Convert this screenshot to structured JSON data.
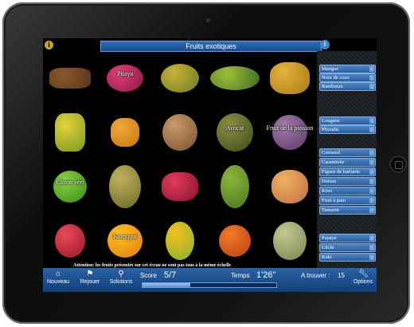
{
  "title": "Fruits exotiques",
  "hint_icon": "lightbulb-icon",
  "info_icon": "info-icon",
  "tiles": [
    {
      "label": "",
      "c1": "#8a5a2e",
      "c2": "#5a3416",
      "w": 52,
      "h": 26,
      "r": "30%"
    },
    {
      "label": "Pitaya",
      "c1": "#e0407a",
      "c2": "#8a1742",
      "w": 46,
      "h": 34,
      "r": "50%"
    },
    {
      "label": "",
      "c1": "#c8b23a",
      "c2": "#6b7a20",
      "w": 48,
      "h": 36,
      "r": "50%"
    },
    {
      "label": "",
      "c1": "#9ebe3a",
      "c2": "#3e6a20",
      "w": 62,
      "h": 30,
      "r": "50%"
    },
    {
      "label": "",
      "c1": "#e6b23a",
      "c2": "#a87a14",
      "w": 50,
      "h": 40,
      "r": "40%"
    },
    {
      "label": "",
      "c1": "#e2d23a",
      "c2": "#7a9a1e",
      "w": 38,
      "h": 48,
      "r": "30%"
    },
    {
      "label": "",
      "c1": "#f0a838",
      "c2": "#c47810",
      "w": 36,
      "h": 36,
      "r": "40%"
    },
    {
      "label": "",
      "c1": "#c89a6a",
      "c2": "#7a5230",
      "w": 44,
      "h": 46,
      "r": "50%"
    },
    {
      "label": "Avocat",
      "c1": "#8a8e44",
      "c2": "#3e4a18",
      "w": 46,
      "h": 48,
      "r": "50%"
    },
    {
      "label": "Fruit de la passion",
      "c1": "#a07aa8",
      "c2": "#5a3a66",
      "w": 44,
      "h": 44,
      "r": "50%"
    },
    {
      "label": "Citron vert",
      "c1": "#86d040",
      "c2": "#3c8a18",
      "w": 42,
      "h": 40,
      "r": "50%"
    },
    {
      "label": "",
      "c1": "#c0b060",
      "c2": "#6a6a22",
      "w": 40,
      "h": 54,
      "r": "50%"
    },
    {
      "label": "",
      "c1": "#e03a5a",
      "c2": "#8a1430",
      "w": 46,
      "h": 36,
      "r": "40%"
    },
    {
      "label": "",
      "c1": "#8ab43a",
      "c2": "#4a7a1e",
      "w": 36,
      "h": 54,
      "r": "50%"
    },
    {
      "label": "",
      "c1": "#f0b060",
      "c2": "#c07040",
      "w": 46,
      "h": 42,
      "r": "45%"
    },
    {
      "label": "",
      "c1": "#e84a5a",
      "c2": "#9a1628",
      "w": 38,
      "h": 42,
      "r": "50%"
    },
    {
      "label": "Kumquat",
      "c1": "#ffc020",
      "c2": "#e07a10",
      "w": 44,
      "h": 42,
      "r": "50%"
    },
    {
      "label": "",
      "c1": "#f0c020",
      "c2": "#8ab030",
      "w": 36,
      "h": 48,
      "r": "50%"
    },
    {
      "label": "",
      "c1": "#f07a2a",
      "c2": "#b8400e",
      "w": 40,
      "h": 40,
      "r": "50%"
    },
    {
      "label": "",
      "c1": "#c4c890",
      "c2": "#7a8250",
      "w": 42,
      "h": 48,
      "r": "50%"
    }
  ],
  "notice": "Attention: les fruits présentés sur cet écran ne sont pas tous à la même échelle",
  "answers": [
    "Mangue",
    "Noix de coco",
    "Rambutan",
    "Longane",
    "Physalis",
    "Corossol",
    "Carambole",
    "Figues de barbarie",
    "Durian",
    "Kiwi",
    "Fruit à pain",
    "Tamarin",
    "Papaye",
    "Litchi",
    "Kaki"
  ],
  "toolbar": {
    "nouveau": "Nouveau",
    "rejouer": "Rejouer",
    "solutions": "Solutions",
    "options": "Options",
    "score_label": "Score",
    "score_value": "5/7",
    "temps_label": "Temps",
    "temps_value": "1'26\"",
    "trouver_label": "A trouver :",
    "trouver_value": "15",
    "progress": 0.36
  },
  "colors": {
    "accent": "#2a63a6",
    "button": "#4f86c4"
  }
}
